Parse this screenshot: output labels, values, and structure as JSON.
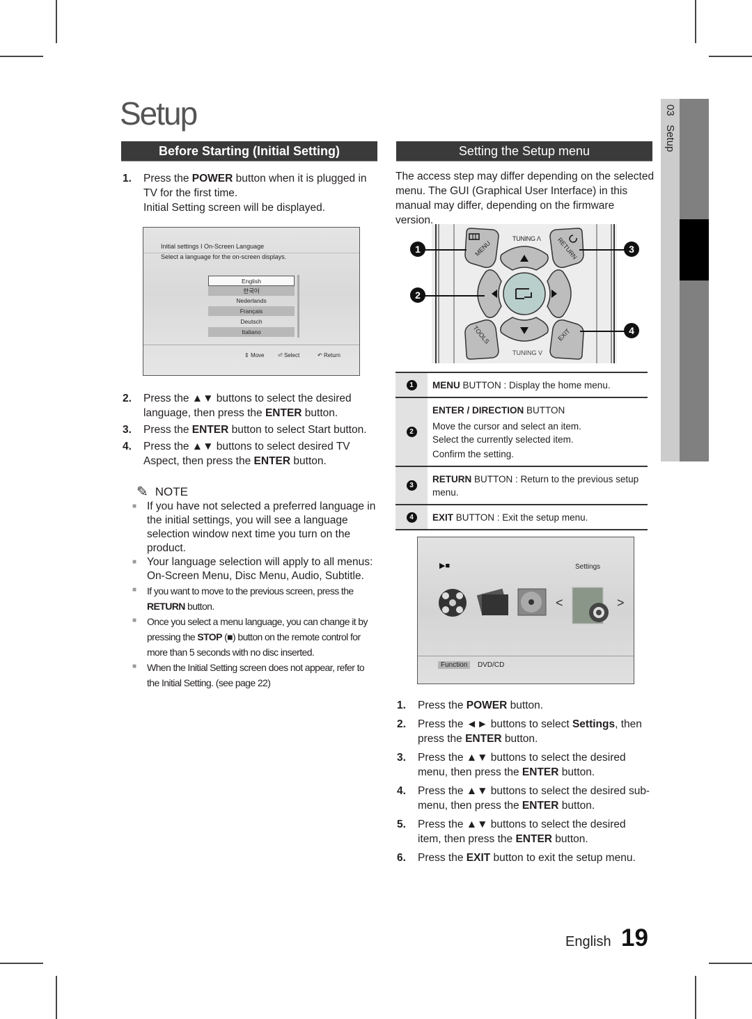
{
  "page": {
    "title": "Setup",
    "chapter_tab": {
      "number": "03",
      "label": "Setup"
    },
    "footer": {
      "language": "English",
      "page_number": "19"
    }
  },
  "left": {
    "section_title": "Before Starting (Initial Setting)",
    "steps_top": [
      {
        "num": "1.",
        "html": "Press the <b>POWER</b> button when it is plugged in TV for the first time.<br>Initial Setting screen will be displayed."
      }
    ],
    "initial_screen": {
      "header": "Initial settings I On-Screen Language",
      "subtitle": "Select a language for the on-screen displays.",
      "languages": [
        "English",
        "한국어",
        "Nederlands",
        "Français",
        "Deutsch",
        "Italiano"
      ],
      "selected": "English",
      "footer": {
        "move": "Move",
        "select": "Select",
        "return": "Return"
      }
    },
    "steps_bottom": [
      {
        "num": "2.",
        "html": "Press the ▲▼ buttons to select the desired language, then press the <b>ENTER</b> button."
      },
      {
        "num": "3.",
        "html": "Press the <b>ENTER</b> button to select Start button."
      },
      {
        "num": "4.",
        "html": "Press the ▲▼ buttons to select desired TV Aspect, then press the <b>ENTER</b> button."
      }
    ],
    "note_heading": "NOTE",
    "notes": [
      {
        "size": "normal",
        "html": "If you have not selected a preferred language in the initial settings, you will see a language selection window next time you turn on the product."
      },
      {
        "size": "normal",
        "html": "Your language selection will apply to all menus: On-Screen Menu, Disc Menu, Audio, Subtitle."
      },
      {
        "size": "small",
        "html": "If you want to move to the previous screen, press the <b>RETURN</b> button."
      },
      {
        "size": "small",
        "html": "Once you select a menu language, you can change it by pressing the <b>STOP</b> (■) button on the remote control for more than 5 seconds with no disc inserted."
      },
      {
        "size": "small",
        "html": "When the Initial Setting screen does not appear, refer to the Initial Setting. (see page 22)"
      }
    ]
  },
  "right": {
    "section_title": "Setting the Setup menu",
    "intro": "The access step may differ depending on the selected menu. The GUI (Graphical User Interface) in this manual may differ, depending on the firmware version.",
    "remote": {
      "tuning_up": "TUNING Λ",
      "tuning_down": "TUNING V",
      "menu": "MENU",
      "return": "RETURN",
      "tools": "TOOLS",
      "exit": "EXIT",
      "callouts": [
        "1",
        "2",
        "3",
        "4"
      ]
    },
    "legend": [
      {
        "no": "1",
        "html": "<b>MENU</b> BUTTON : Display the home menu."
      },
      {
        "no": "2",
        "html": "<b>ENTER / DIRECTION</b> BUTTON<br><span style='display:block;margin-top:4px'>Move the cursor and select an item.<br>Select the currently selected item.</span><span style='display:block;margin-top:2px'>Confirm the setting.</span>"
      },
      {
        "no": "3",
        "html": "<b>RETURN</b> BUTTON : Return to the previous setup menu."
      },
      {
        "no": "4",
        "html": "<b>EXIT</b> BUTTON : Exit the setup menu."
      }
    ],
    "home_screen": {
      "selected_label": "Settings",
      "function_label": "Function",
      "source_label": "DVD/CD",
      "icons": [
        "video-reel-icon",
        "photo-stack-icon",
        "music-disc-icon",
        "settings-gear-icon"
      ]
    },
    "steps": [
      {
        "num": "1.",
        "html": "Press the <b>POWER</b> button."
      },
      {
        "num": "2.",
        "html": "Press the ◄► buttons to select <b>Settings</b>, then press the <b>ENTER</b> button."
      },
      {
        "num": "3.",
        "html": "Press the ▲▼ buttons to select the desired menu, then press the <b>ENTER</b> button."
      },
      {
        "num": "4.",
        "html": "Press the ▲▼ buttons to select the desired sub-menu, then press the <b>ENTER</b> button."
      },
      {
        "num": "5.",
        "html": "Press the ▲▼ buttons to select the desired item, then press the <b>ENTER</b> button."
      },
      {
        "num": "6.",
        "html": "Press the <b>EXIT</b> button to exit the setup menu."
      }
    ]
  },
  "colors": {
    "section_bar": "#3a3a3a",
    "tab_light": "#cccccc",
    "tab_dark": "#808080",
    "tab_active": "#000000",
    "enter_button": "#b9cfcb"
  }
}
